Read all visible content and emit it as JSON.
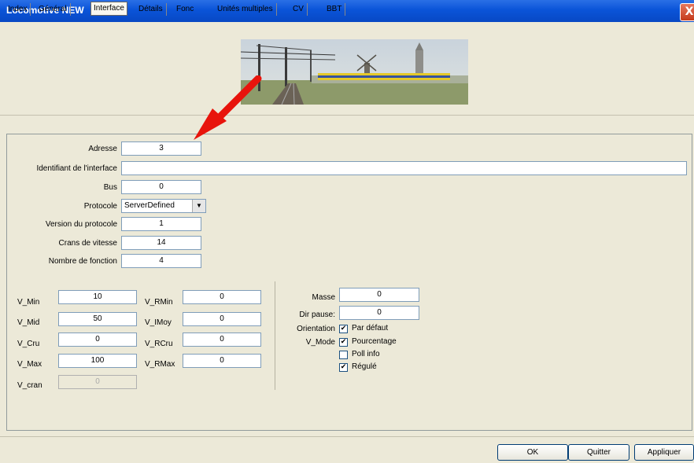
{
  "window": {
    "title": "Locomotive NEW",
    "close_glyph": "X"
  },
  "tabs": [
    {
      "label": "Index"
    },
    {
      "label": "Général"
    },
    {
      "label": "Interface",
      "active": true
    },
    {
      "label": "Détails"
    },
    {
      "label": "Fonc"
    },
    {
      "label": "Unités multiples"
    },
    {
      "label": "CV"
    },
    {
      "label": "BBT"
    }
  ],
  "form": {
    "adresse": {
      "label": "Adresse",
      "value": "3"
    },
    "identifiant": {
      "label": "Identifiant de l'interface",
      "value": ""
    },
    "bus": {
      "label": "Bus",
      "value": "0"
    },
    "protocole": {
      "label": "Protocole",
      "value": "ServerDefined"
    },
    "version": {
      "label": "Version du protocole",
      "value": "1"
    },
    "crans": {
      "label": "Crans de vitesse",
      "value": "14"
    },
    "nb_fonction": {
      "label": "Nombre de fonction",
      "value": "4"
    }
  },
  "speed": {
    "v_min": {
      "label": "V_Min",
      "value": "10"
    },
    "v_mid": {
      "label": "V_Mid",
      "value": "50"
    },
    "v_cru": {
      "label": "V_Cru",
      "value": "0"
    },
    "v_max": {
      "label": "V_Max",
      "value": "100"
    },
    "v_cran": {
      "label": "V_cran",
      "value": "0"
    },
    "v_rmin": {
      "label": "V_RMin",
      "value": "0"
    },
    "v_imoy": {
      "label": "V_IMoy",
      "value": "0"
    },
    "v_rcru": {
      "label": "V_RCru",
      "value": "0"
    },
    "v_rmax": {
      "label": "V_RMax",
      "value": "0"
    }
  },
  "right": {
    "masse": {
      "label": "Masse",
      "value": "0"
    },
    "dir_pause": {
      "label": "Dir pause:",
      "value": "0"
    },
    "orientation_label": "Orientation",
    "vmode_label": "V_Mode",
    "checks": [
      {
        "label": "Par défaut",
        "checked": true
      },
      {
        "label": "Pourcentage",
        "checked": true
      },
      {
        "label": "Poll info",
        "checked": false
      },
      {
        "label": "Régulé",
        "checked": true
      }
    ]
  },
  "buttons": {
    "ok": "OK",
    "quitter": "Quitter",
    "appliquer": "Appliquer"
  },
  "colors": {
    "titlebar": "#0a54d8",
    "arrow": "#e8140c",
    "panel": "#ece9d8"
  }
}
